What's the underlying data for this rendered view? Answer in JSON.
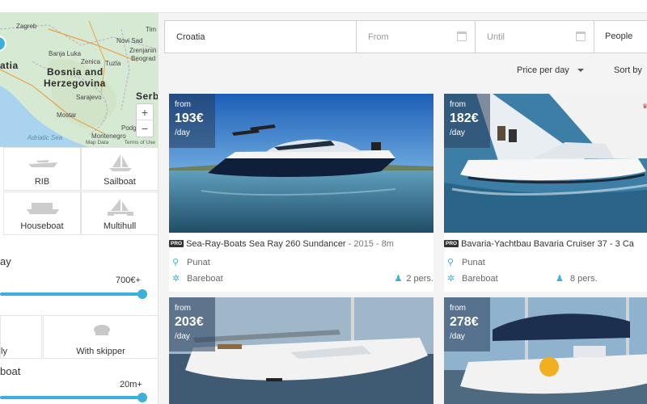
{
  "map": {
    "country_label": "atia",
    "region_label_1": "Bosnia and",
    "region_label_2": "Herzegovina",
    "cities": [
      "Zagreb",
      "Novi Sad",
      "Beograd",
      "Sarajevo",
      "Montenegro",
      "Banja Luka",
      "Tuzla",
      "Zenica",
      "Mostar",
      "Podgorica",
      "Serb"
    ],
    "city_tim": "Tim",
    "city_zrenjanin": "Zrenjanin",
    "adriatic": "Adriatic Sea",
    "credit": "Map Data",
    "terms": "Terms of Use",
    "zoom_in": "+",
    "zoom_out": "−"
  },
  "boat_types": [
    {
      "label": "RIB",
      "icon": "rib-icon"
    },
    {
      "label": "Sailboat",
      "icon": "sailboat-icon"
    },
    {
      "label": "Houseboat",
      "icon": "houseboat-icon"
    },
    {
      "label": "Multihull",
      "icon": "multihull-icon"
    }
  ],
  "price_filter": {
    "title": "ay",
    "max_label": "700€+",
    "level": 1.0
  },
  "modes": {
    "left_label": "ly",
    "skipper_label": "With skipper"
  },
  "length_filter": {
    "title": "boat",
    "max_label": "20m+",
    "level": 1.0
  },
  "search": {
    "destination_value": "Croatia",
    "from_placeholder": "From",
    "until_placeholder": "Until",
    "people_label": "People"
  },
  "sort": {
    "price_label": "Price per day",
    "sort_label": "Sort by"
  },
  "listings": [
    {
      "from": "from",
      "price": "193€",
      "per": "/day",
      "pro": "PRO",
      "title": "Sea-Ray-Boats Sea Ray 260 Sundancer",
      "meta": " - 2015 - 8m",
      "location": "Punat",
      "mode": "Bareboat",
      "people": "2 pers."
    },
    {
      "from": "from",
      "price": "182€",
      "per": "/day",
      "pro": "PRO",
      "title": "Bavaria-Yachtbau Bavaria Cruiser 37 - 3 Ca",
      "meta": "",
      "location": "Punat",
      "mode": "Bareboat",
      "people": "8 pers."
    },
    {
      "from": "from",
      "price": "203€",
      "per": "/day",
      "pro": "",
      "title": "",
      "meta": "",
      "location": "",
      "mode": "",
      "people": ""
    },
    {
      "from": "from",
      "price": "278€",
      "per": "/day",
      "pro": "",
      "title": "",
      "meta": "",
      "location": "",
      "mode": "",
      "people": ""
    }
  ],
  "colors": {
    "accent": "#3bb0d9",
    "text": "#333333",
    "bg": "#f4f4f4"
  }
}
